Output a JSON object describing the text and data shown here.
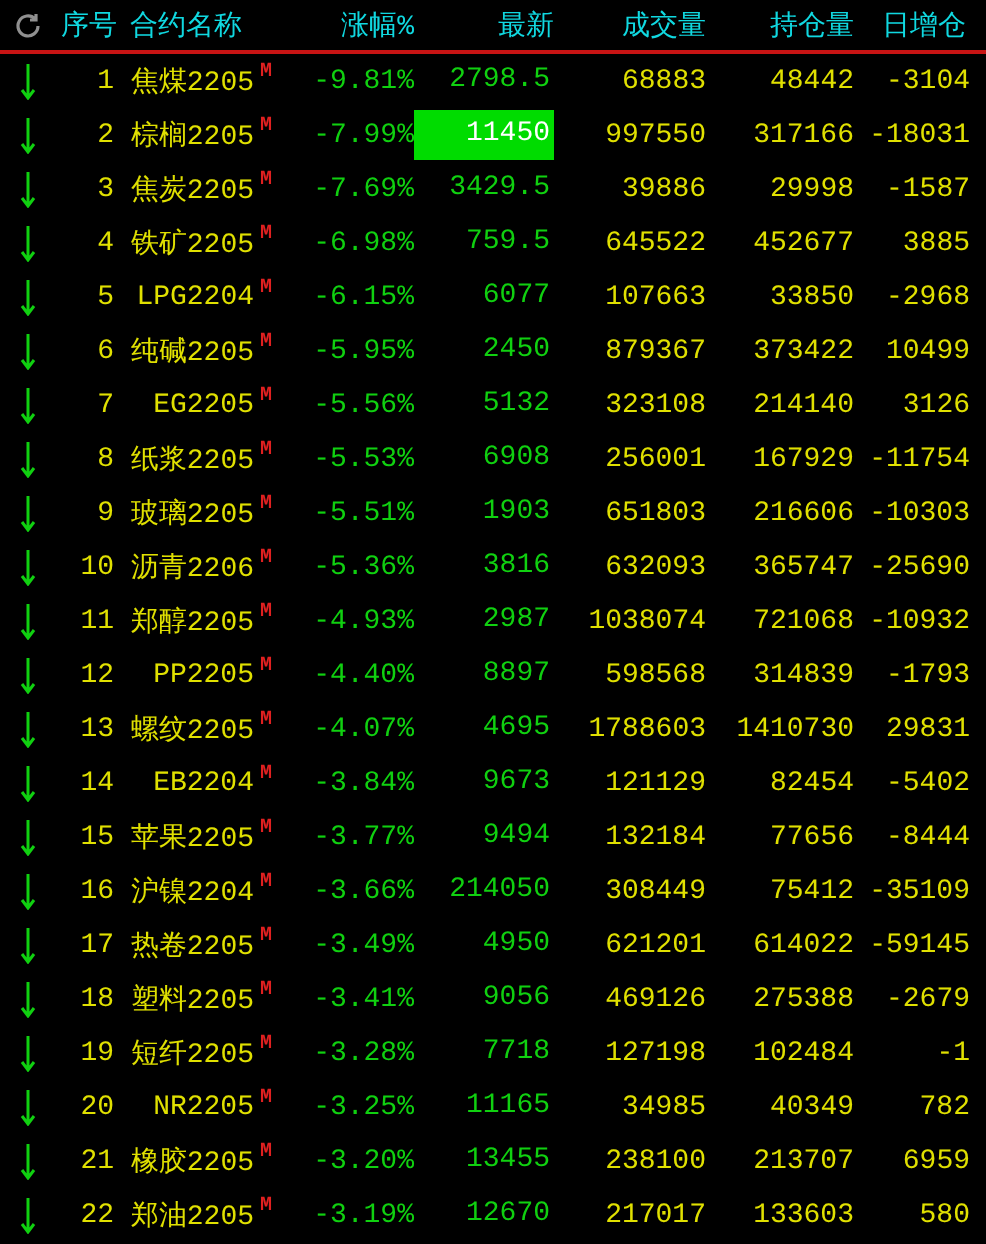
{
  "header": {
    "columns": [
      "序号",
      "合约名称",
      "涨幅%",
      "最新",
      "成交量",
      "持仓量",
      "日增仓"
    ]
  },
  "rows": [
    {
      "kind": "down",
      "no": "1",
      "name": "焦煤2205",
      "mark": "M",
      "change": "-9.81%",
      "last": "2798.5",
      "last_flash": false,
      "volume": "68883",
      "open_interest": "48442",
      "oi_change": "-3104"
    },
    {
      "kind": "down",
      "no": "2",
      "name": "棕榈2205",
      "mark": "M",
      "change": "-7.99%",
      "last": "11450",
      "last_flash": true,
      "volume": "997550",
      "open_interest": "317166",
      "oi_change": "-18031"
    },
    {
      "kind": "down",
      "no": "3",
      "name": "焦炭2205",
      "mark": "M",
      "change": "-7.69%",
      "last": "3429.5",
      "last_flash": false,
      "volume": "39886",
      "open_interest": "29998",
      "oi_change": "-1587"
    },
    {
      "kind": "down",
      "no": "4",
      "name": "铁矿2205",
      "mark": "M",
      "change": "-6.98%",
      "last": "759.5",
      "last_flash": false,
      "volume": "645522",
      "open_interest": "452677",
      "oi_change": "3885"
    },
    {
      "kind": "down",
      "no": "5",
      "name": "LPG2204",
      "mark": "M",
      "change": "-6.15%",
      "last": "6077",
      "last_flash": false,
      "volume": "107663",
      "open_interest": "33850",
      "oi_change": "-2968"
    },
    {
      "kind": "down",
      "no": "6",
      "name": "纯碱2205",
      "mark": "M",
      "change": "-5.95%",
      "last": "2450",
      "last_flash": false,
      "volume": "879367",
      "open_interest": "373422",
      "oi_change": "10499"
    },
    {
      "kind": "down",
      "no": "7",
      "name": "EG2205",
      "mark": "M",
      "change": "-5.56%",
      "last": "5132",
      "last_flash": false,
      "volume": "323108",
      "open_interest": "214140",
      "oi_change": "3126"
    },
    {
      "kind": "down",
      "no": "8",
      "name": "纸浆2205",
      "mark": "M",
      "change": "-5.53%",
      "last": "6908",
      "last_flash": false,
      "volume": "256001",
      "open_interest": "167929",
      "oi_change": "-11754"
    },
    {
      "kind": "down",
      "no": "9",
      "name": "玻璃2205",
      "mark": "M",
      "change": "-5.51%",
      "last": "1903",
      "last_flash": false,
      "volume": "651803",
      "open_interest": "216606",
      "oi_change": "-10303"
    },
    {
      "kind": "down",
      "no": "10",
      "name": "沥青2206",
      "mark": "M",
      "change": "-5.36%",
      "last": "3816",
      "last_flash": false,
      "volume": "632093",
      "open_interest": "365747",
      "oi_change": "-25690"
    },
    {
      "kind": "down",
      "no": "11",
      "name": "郑醇2205",
      "mark": "M",
      "change": "-4.93%",
      "last": "2987",
      "last_flash": false,
      "volume": "1038074",
      "open_interest": "721068",
      "oi_change": "-10932"
    },
    {
      "kind": "down",
      "no": "12",
      "name": "PP2205",
      "mark": "M",
      "change": "-4.40%",
      "last": "8897",
      "last_flash": false,
      "volume": "598568",
      "open_interest": "314839",
      "oi_change": "-1793"
    },
    {
      "kind": "down",
      "no": "13",
      "name": "螺纹2205",
      "mark": "M",
      "change": "-4.07%",
      "last": "4695",
      "last_flash": false,
      "volume": "1788603",
      "open_interest": "1410730",
      "oi_change": "29831"
    },
    {
      "kind": "down",
      "no": "14",
      "name": "EB2204",
      "mark": "M",
      "change": "-3.84%",
      "last": "9673",
      "last_flash": false,
      "volume": "121129",
      "open_interest": "82454",
      "oi_change": "-5402"
    },
    {
      "kind": "down",
      "no": "15",
      "name": "苹果2205",
      "mark": "M",
      "change": "-3.77%",
      "last": "9494",
      "last_flash": false,
      "volume": "132184",
      "open_interest": "77656",
      "oi_change": "-8444"
    },
    {
      "kind": "down",
      "no": "16",
      "name": "沪镍2204",
      "mark": "M",
      "change": "-3.66%",
      "last": "214050",
      "last_flash": false,
      "volume": "308449",
      "open_interest": "75412",
      "oi_change": "-35109"
    },
    {
      "kind": "down",
      "no": "17",
      "name": "热卷2205",
      "mark": "M",
      "change": "-3.49%",
      "last": "4950",
      "last_flash": false,
      "volume": "621201",
      "open_interest": "614022",
      "oi_change": "-59145"
    },
    {
      "kind": "down",
      "no": "18",
      "name": "塑料2205",
      "mark": "M",
      "change": "-3.41%",
      "last": "9056",
      "last_flash": false,
      "volume": "469126",
      "open_interest": "275388",
      "oi_change": "-2679"
    },
    {
      "kind": "down",
      "no": "19",
      "name": "短纤2205",
      "mark": "M",
      "change": "-3.28%",
      "last": "7718",
      "last_flash": false,
      "volume": "127198",
      "open_interest": "102484",
      "oi_change": "-1"
    },
    {
      "kind": "down",
      "no": "20",
      "name": "NR2205",
      "mark": "M",
      "change": "-3.25%",
      "last": "11165",
      "last_flash": false,
      "volume": "34985",
      "open_interest": "40349",
      "oi_change": "782"
    },
    {
      "kind": "down",
      "no": "21",
      "name": "橡胶2205",
      "mark": "M",
      "change": "-3.20%",
      "last": "13455",
      "last_flash": false,
      "volume": "238100",
      "open_interest": "213707",
      "oi_change": "6959"
    },
    {
      "kind": "down",
      "no": "22",
      "name": "郑油2205",
      "mark": "M",
      "change": "-3.19%",
      "last": "12670",
      "last_flash": false,
      "volume": "217017",
      "open_interest": "133603",
      "oi_change": "580"
    }
  ]
}
